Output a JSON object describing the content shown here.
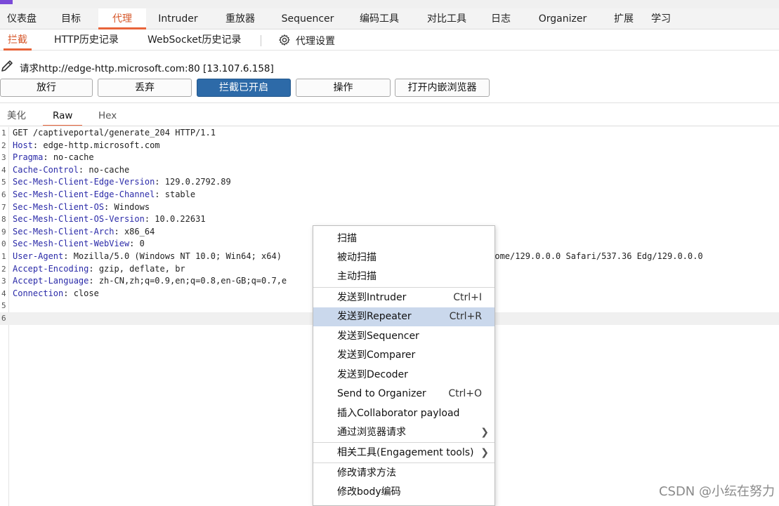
{
  "colors": {
    "accent": "#e8643a",
    "primary_button": "#2d6aa8",
    "menu_highlight": "#cad8ec",
    "header_key": "#2a2aa8"
  },
  "main_tabs": [
    "仪表盘",
    "目标",
    "代理",
    "Intruder",
    "重放器",
    "Sequencer",
    "编码工具",
    "对比工具",
    "日志",
    "Organizer",
    "扩展",
    "学习"
  ],
  "sub_tabs": {
    "intercept": "拦截",
    "http_history": "HTTP历史记录",
    "websocket_history": "WebSocket历史记录",
    "proxy_settings": "代理设置"
  },
  "request_info": "请求http://edge-http.microsoft.com:80  [13.107.6.158]",
  "buttons": {
    "forward": "放行",
    "drop": "丢弃",
    "intercept_on": "拦截已开启",
    "action": "操作",
    "open_browser": "打开内嵌浏览器"
  },
  "editor_tabs": {
    "pretty": "美化",
    "raw": "Raw",
    "hex": "Hex"
  },
  "request_lines": [
    {
      "num": "1",
      "text": "GET /captiveportal/generate_204 HTTP/1.1"
    },
    {
      "num": "2",
      "key": "Host",
      "value": " edge-http.microsoft.com"
    },
    {
      "num": "3",
      "key": "Pragma",
      "value": " no-cache"
    },
    {
      "num": "4",
      "key": "Cache-Control",
      "value": " no-cache"
    },
    {
      "num": "5",
      "key": "Sec-Mesh-Client-Edge-Version",
      "value": " 129.0.2792.89"
    },
    {
      "num": "6",
      "key": "Sec-Mesh-Client-Edge-Channel",
      "value": " stable"
    },
    {
      "num": "7",
      "key": "Sec-Mesh-Client-OS",
      "value": " Windows"
    },
    {
      "num": "8",
      "key": "Sec-Mesh-Client-OS-Version",
      "value": " 10.0.22631"
    },
    {
      "num": "9",
      "key": "Sec-Mesh-Client-Arch",
      "value": " x86_64"
    },
    {
      "num": "0",
      "key": "Sec-Mesh-Client-WebView",
      "value": " 0"
    },
    {
      "num": "1",
      "key": "User-Agent",
      "value": " Mozilla/5.0 (Windows NT 10.0; Win64; x64)                                Gecko) Chrome/129.0.0.0 Safari/537.36 Edg/129.0.0.0"
    },
    {
      "num": "2",
      "key": "Accept-Encoding",
      "value": " gzip, deflate, br"
    },
    {
      "num": "3",
      "key": "Accept-Language",
      "value": " zh-CN,zh;q=0.9,en;q=0.8,en-GB;q=0.7,e"
    },
    {
      "num": "4",
      "key": "Connection",
      "value": " close"
    },
    {
      "num": "5",
      "text": ""
    },
    {
      "num": "6",
      "text": ""
    }
  ],
  "context_menu": {
    "scan": "扫描",
    "passive_scan": "被动扫描",
    "active_scan": "主动扫描",
    "send_intruder": "发送到Intruder",
    "send_intruder_sc": "Ctrl+I",
    "send_repeater": "发送到Repeater",
    "send_repeater_sc": "Ctrl+R",
    "send_sequencer": "发送到Sequencer",
    "send_comparer": "发送到Comparer",
    "send_decoder": "发送到Decoder",
    "send_organizer": "Send to Organizer",
    "send_organizer_sc": "Ctrl+O",
    "insert_collaborator": "插入Collaborator payload",
    "request_in_browser": "通过浏览器请求",
    "engagement_tools": "相关工具(Engagement tools)",
    "change_method": "修改请求方法",
    "change_body_encoding": "修改body编码"
  },
  "watermark": "CSDN @小纭在努力"
}
